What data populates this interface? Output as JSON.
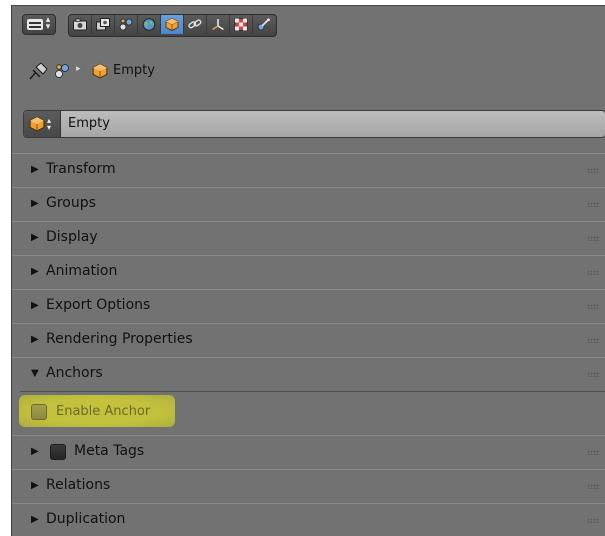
{
  "header": {
    "editor_type_icon": "properties-editor-icon",
    "context_tabs": [
      {
        "name": "render",
        "icon": "camera-icon",
        "active": false
      },
      {
        "name": "render-layers",
        "icon": "render-layers-icon",
        "active": false
      },
      {
        "name": "scene",
        "icon": "scene-icon",
        "active": false
      },
      {
        "name": "world",
        "icon": "world-icon",
        "active": false
      },
      {
        "name": "object",
        "icon": "object-cube-icon",
        "active": true
      },
      {
        "name": "constraints",
        "icon": "constraint-link-icon",
        "active": false
      },
      {
        "name": "object-data",
        "icon": "empty-axes-icon",
        "active": false
      },
      {
        "name": "texture",
        "icon": "texture-checker-icon",
        "active": false
      },
      {
        "name": "physics",
        "icon": "physics-icon",
        "active": false
      }
    ]
  },
  "breadcrumb": {
    "object_label": "Empty"
  },
  "datablock": {
    "name": "Empty"
  },
  "panels": [
    {
      "label": "Transform",
      "expanded": false
    },
    {
      "label": "Groups",
      "expanded": false
    },
    {
      "label": "Display",
      "expanded": false
    },
    {
      "label": "Animation",
      "expanded": false
    },
    {
      "label": "Export Options",
      "expanded": false
    },
    {
      "label": "Rendering Properties",
      "expanded": false
    },
    {
      "label": "Anchors",
      "expanded": true
    },
    {
      "label": "Meta Tags",
      "expanded": false,
      "checkbox": true
    },
    {
      "label": "Relations",
      "expanded": false
    },
    {
      "label": "Duplication",
      "expanded": false
    }
  ],
  "anchors": {
    "enable_anchor_label": "Enable Anchor",
    "enable_anchor_checked": false
  },
  "glyphs": {
    "collapsed": "▶",
    "expanded": "▼",
    "breadcrumb_sep": "▸",
    "updown": "▴▾"
  },
  "colors": {
    "panel_bg": "#727272",
    "active_tab": "#5a94d8",
    "highlight": "#c8c63a",
    "object_orange": "#f0a030"
  }
}
